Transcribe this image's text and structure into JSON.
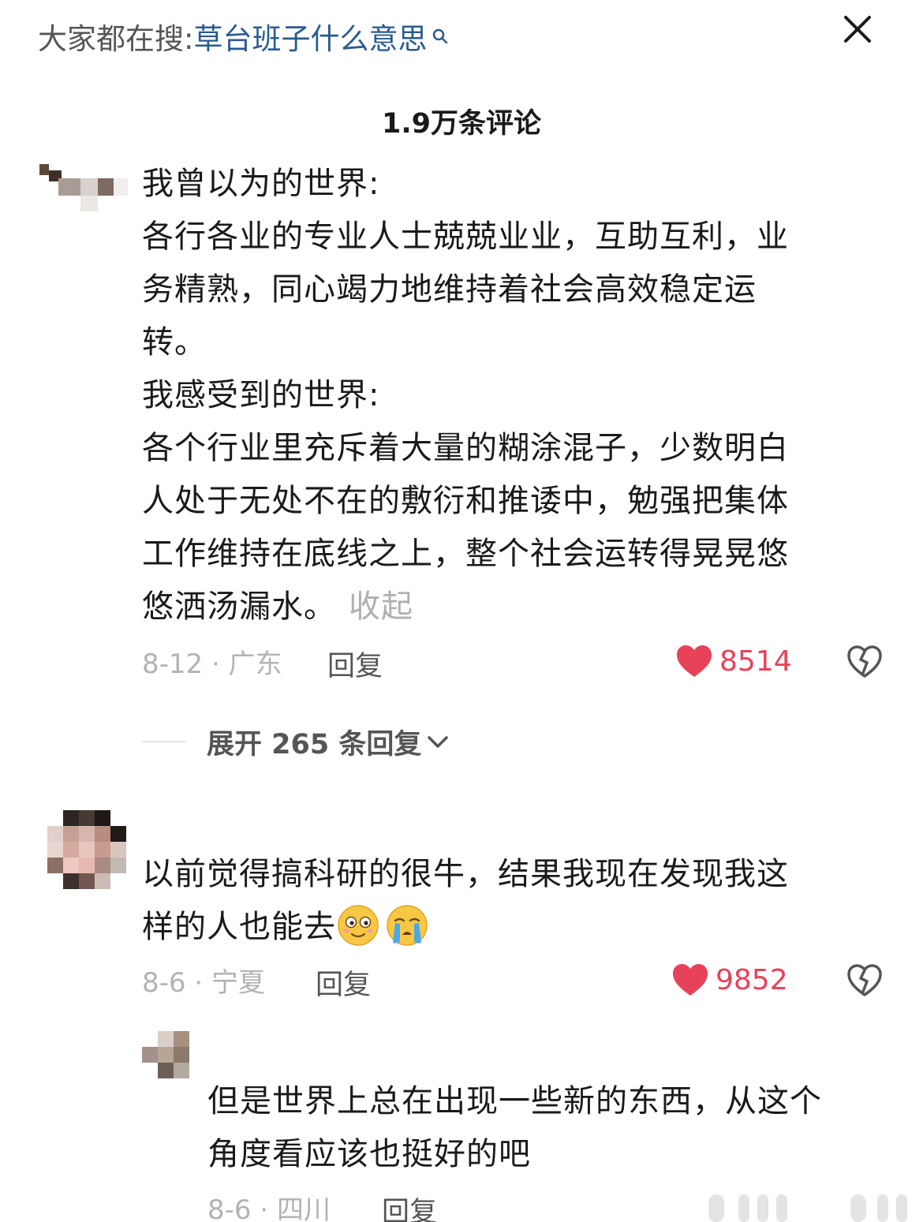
{
  "search": {
    "prefix": "大家都在搜:",
    "term": "草台班子什么意思"
  },
  "header": {
    "comment_count": "1.9万条评论"
  },
  "comments": [
    {
      "lines": [
        "我曾以为的世界:",
        "各行各业的专业人士兢兢业业，互助互利，业",
        "务精熟，同心竭力地维持着社会高效稳定运",
        "转。",
        "我感受到的世界:",
        "各个行业里充斥着大量的糊涂混子，少数明白",
        "人处于无处不在的敷衍和推诿中，勉强把集体",
        "工作维持在底线之上，整个社会运转得晃晃悠",
        "悠洒汤漏水。"
      ],
      "collapse_label": "收起",
      "date_location": "8-12 · 广东",
      "reply_label": "回复",
      "likes": "8514",
      "expand_label": "展开 265 条回复"
    },
    {
      "lines": [
        "以前觉得搞科研的很牛，结果我现在发现我这",
        "样的人也能去"
      ],
      "emojis": [
        "smug-face-emoji",
        "crying-face-emoji"
      ],
      "date_location": "8-6 · 宁夏",
      "reply_label": "回复",
      "likes": "9852"
    },
    {
      "lines": [
        "但是世界上总在出现一些新的东西，从这个",
        "角度看应该也挺好的吧"
      ],
      "date_location": "8-6 · 四川",
      "reply_label": "回复"
    }
  ],
  "colors": {
    "like": "#e8425a",
    "link": "#2a5b8f",
    "meta": "#b3b3b3"
  }
}
